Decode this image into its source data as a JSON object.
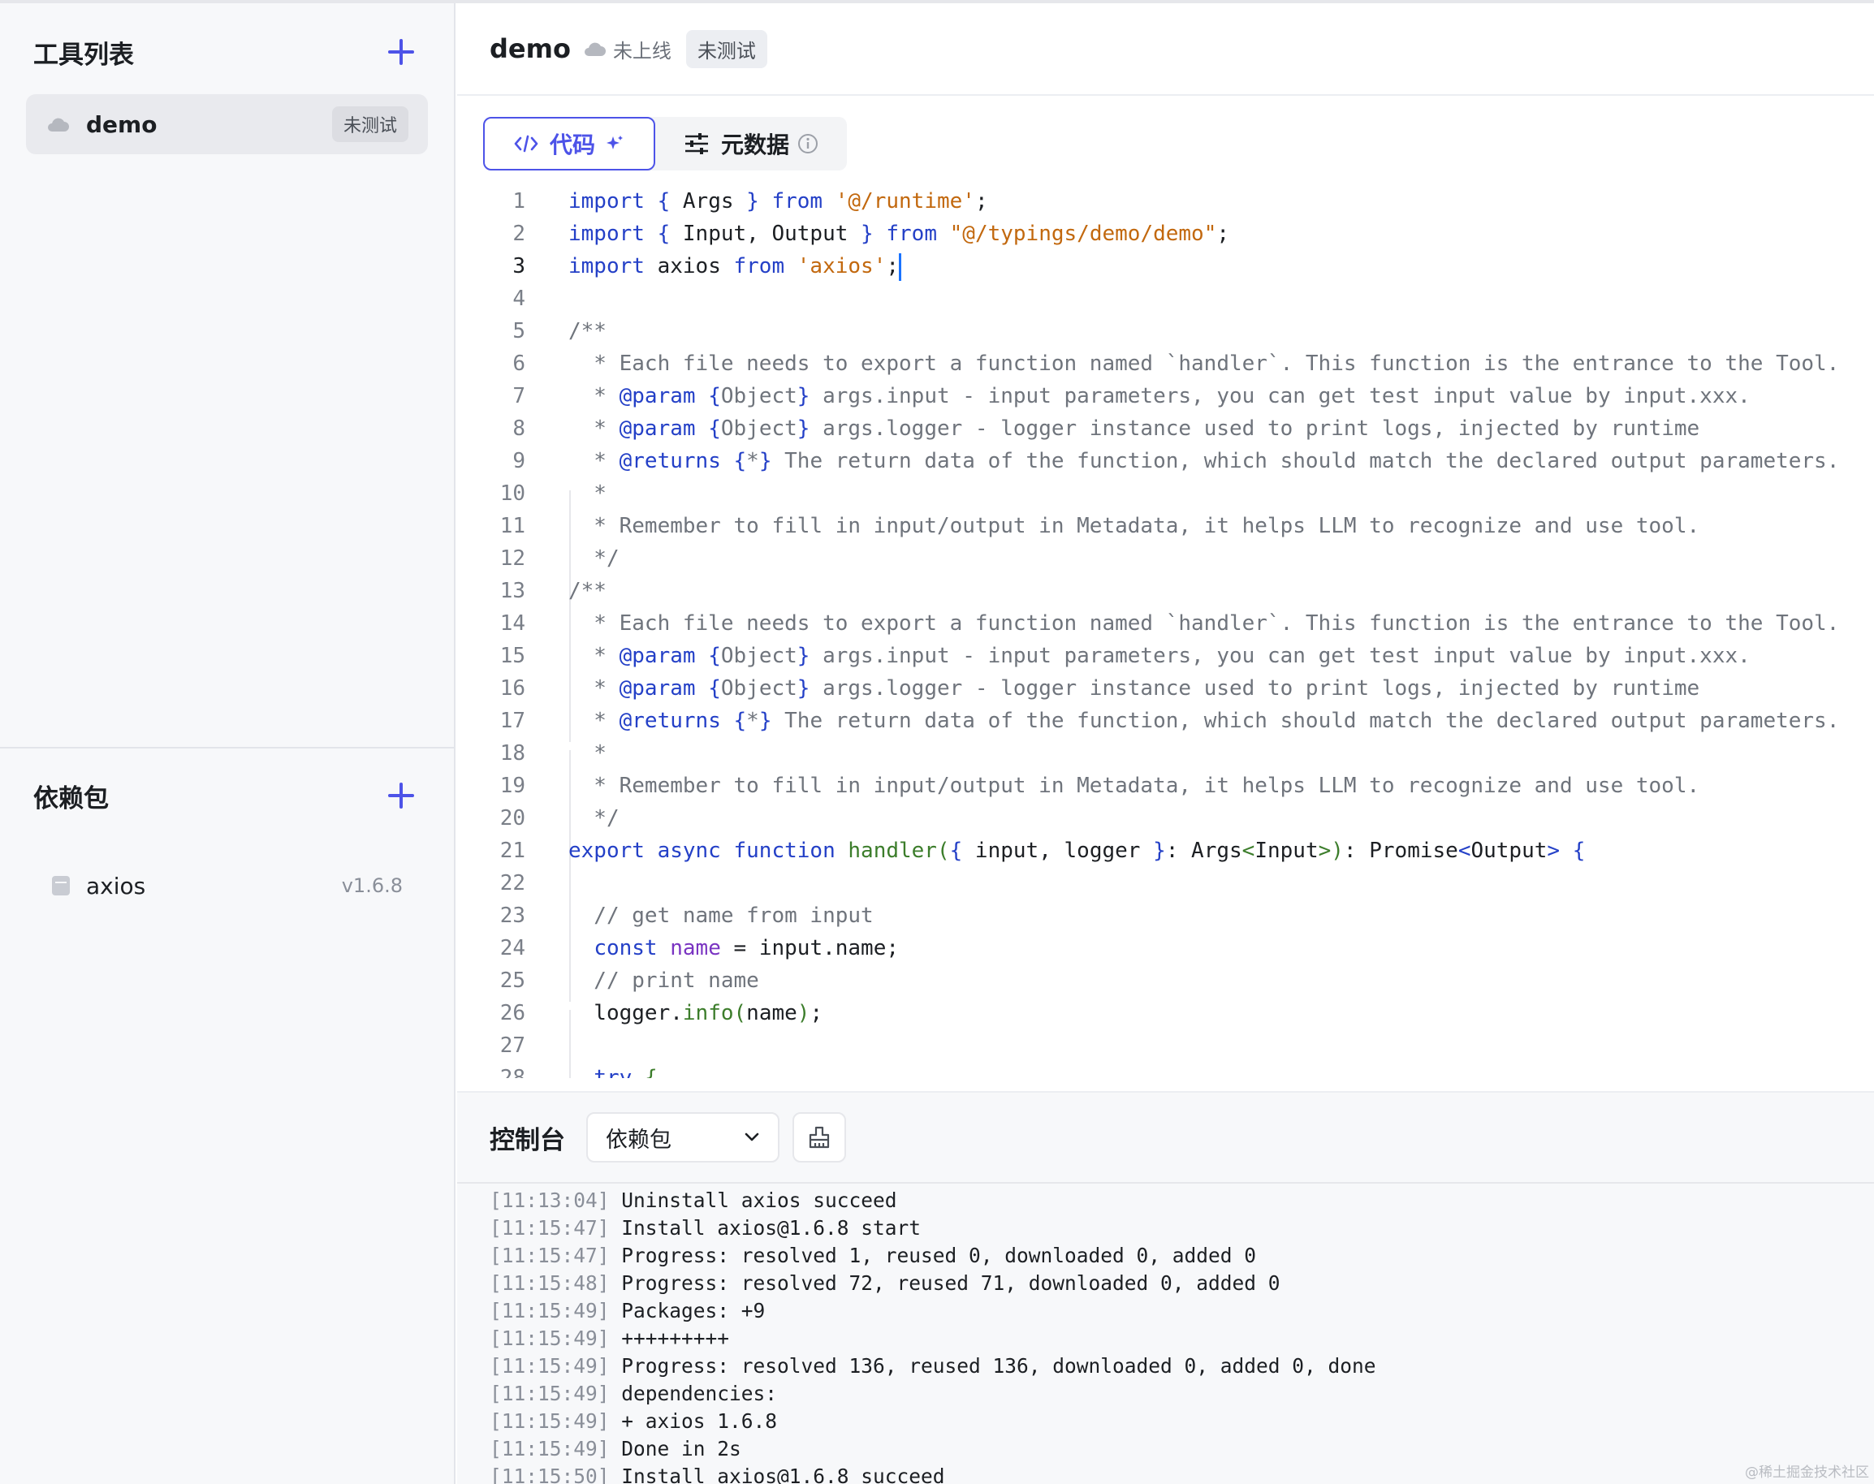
{
  "sidebar": {
    "tools_title": "工具列表",
    "tools": [
      {
        "name": "demo",
        "tag": "未测试"
      }
    ],
    "deps_title": "依赖包",
    "deps": [
      {
        "name": "axios",
        "version": "v1.6.8"
      }
    ]
  },
  "header": {
    "title": "demo",
    "status": "未上线",
    "tag": "未测试"
  },
  "tabs": {
    "code": "代码",
    "metadata": "元数据"
  },
  "editor": {
    "current_line": 3
  },
  "console": {
    "title": "控制台",
    "select_value": "依赖包",
    "logs": [
      {
        "time": "[11:13:04]",
        "text": "Uninstall axios succeed"
      },
      {
        "time": "[11:15:47]",
        "text": "Install axios@1.6.8 start"
      },
      {
        "time": "[11:15:47]",
        "text": "Progress: resolved 1, reused 0, downloaded 0, added 0"
      },
      {
        "time": "[11:15:48]",
        "text": "Progress: resolved 72, reused 71, downloaded 0, added 0"
      },
      {
        "time": "[11:15:49]",
        "text": "Packages: +9"
      },
      {
        "time": "[11:15:49]",
        "text": "+++++++++"
      },
      {
        "time": "[11:15:49]",
        "text": "Progress: resolved 136, reused 136, downloaded 0, added 0, done"
      },
      {
        "time": "[11:15:49]",
        "text": "dependencies:"
      },
      {
        "time": "[11:15:49]",
        "text": "+ axios 1.6.8"
      },
      {
        "time": "[11:15:49]",
        "text": "Done in 2s"
      },
      {
        "time": "[11:15:50]",
        "text": "Install axios@1.6.8 succeed"
      }
    ]
  },
  "watermark": "@稀土掘金技术社区",
  "colors": {
    "accent": "#4d53e8",
    "keyword": "#2440c7",
    "string": "#c2680e",
    "comment": "#6f747c",
    "function": "#3c7d2b"
  }
}
